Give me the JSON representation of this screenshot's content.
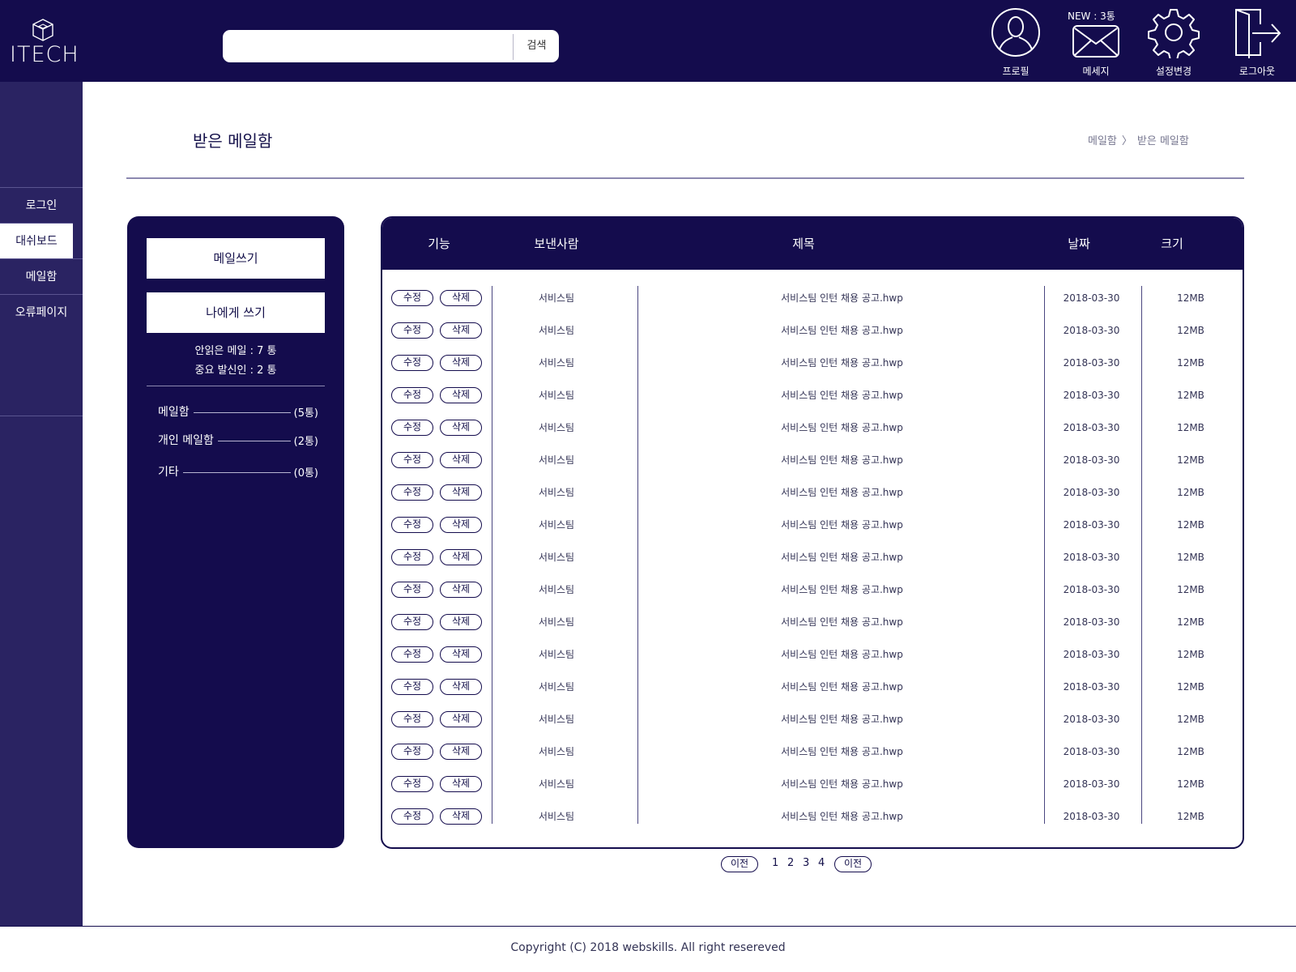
{
  "header": {
    "logo_text": "ITECH",
    "search": {
      "placeholder": "",
      "button": "검색"
    },
    "new_badge": "NEW : 3통",
    "icons": [
      {
        "name": "user-icon",
        "label": "프로필"
      },
      {
        "name": "mail-icon",
        "label": "메세지"
      },
      {
        "name": "gear-icon",
        "label": "설정변경"
      },
      {
        "name": "logout-icon",
        "label": "로그아웃"
      }
    ]
  },
  "nav": {
    "items": [
      {
        "label": "로그인",
        "active": false
      },
      {
        "label": "대쉬보드",
        "active": true
      },
      {
        "label": "메일함",
        "active": false
      },
      {
        "label": "오류페이지",
        "active": false
      }
    ]
  },
  "page": {
    "title": "받은 메일함",
    "breadcrumb": [
      "메일함",
      "〉",
      "받은 메일함"
    ]
  },
  "side": {
    "compose": "메일쓰기",
    "to_self": "나에게 쓰기",
    "unread": "안읽은 메일 : 7 통",
    "important": "중요 발신인 : 2 통",
    "folders": [
      {
        "name": "메일함",
        "count": "(5통)"
      },
      {
        "name": "개인 메일함",
        "count": "(2통)"
      },
      {
        "name": "기타",
        "count": "(0통)"
      }
    ]
  },
  "table": {
    "columns": [
      "기능",
      "보낸사람",
      "제목",
      "날짜",
      "크기"
    ],
    "edit_label": "수정",
    "delete_label": "삭제",
    "rows": [
      {
        "sender": "서비스팀",
        "subject": "서비스팀 인턴 채용 공고.hwp",
        "date": "2018-03-30",
        "size": "12MB"
      },
      {
        "sender": "서비스팀",
        "subject": "서비스팀 인턴 채용 공고.hwp",
        "date": "2018-03-30",
        "size": "12MB"
      },
      {
        "sender": "서비스팀",
        "subject": "서비스팀 인턴 채용 공고.hwp",
        "date": "2018-03-30",
        "size": "12MB"
      },
      {
        "sender": "서비스팀",
        "subject": "서비스팀 인턴 채용 공고.hwp",
        "date": "2018-03-30",
        "size": "12MB"
      },
      {
        "sender": "서비스팀",
        "subject": "서비스팀 인턴 채용 공고.hwp",
        "date": "2018-03-30",
        "size": "12MB"
      },
      {
        "sender": "서비스팀",
        "subject": "서비스팀 인턴 채용 공고.hwp",
        "date": "2018-03-30",
        "size": "12MB"
      },
      {
        "sender": "서비스팀",
        "subject": "서비스팀 인턴 채용 공고.hwp",
        "date": "2018-03-30",
        "size": "12MB"
      },
      {
        "sender": "서비스팀",
        "subject": "서비스팀 인턴 채용 공고.hwp",
        "date": "2018-03-30",
        "size": "12MB"
      },
      {
        "sender": "서비스팀",
        "subject": "서비스팀 인턴 채용 공고.hwp",
        "date": "2018-03-30",
        "size": "12MB"
      },
      {
        "sender": "서비스팀",
        "subject": "서비스팀 인턴 채용 공고.hwp",
        "date": "2018-03-30",
        "size": "12MB"
      },
      {
        "sender": "서비스팀",
        "subject": "서비스팀 인턴 채용 공고.hwp",
        "date": "2018-03-30",
        "size": "12MB"
      },
      {
        "sender": "서비스팀",
        "subject": "서비스팀 인턴 채용 공고.hwp",
        "date": "2018-03-30",
        "size": "12MB"
      },
      {
        "sender": "서비스팀",
        "subject": "서비스팀 인턴 채용 공고.hwp",
        "date": "2018-03-30",
        "size": "12MB"
      },
      {
        "sender": "서비스팀",
        "subject": "서비스팀 인턴 채용 공고.hwp",
        "date": "2018-03-30",
        "size": "12MB"
      },
      {
        "sender": "서비스팀",
        "subject": "서비스팀 인턴 채용 공고.hwp",
        "date": "2018-03-30",
        "size": "12MB"
      },
      {
        "sender": "서비스팀",
        "subject": "서비스팀 인턴 채용 공고.hwp",
        "date": "2018-03-30",
        "size": "12MB"
      },
      {
        "sender": "서비스팀",
        "subject": "서비스팀 인턴 채용 공고.hwp",
        "date": "2018-03-30",
        "size": "12MB"
      }
    ]
  },
  "pagination": {
    "prev": "이전",
    "pages": [
      "1",
      "2",
      "3",
      "4"
    ],
    "next": "이전"
  },
  "footer": {
    "copyright": "Copyright (C) 2018 webskills. All right resereved"
  },
  "colors": {
    "primary": "#140c4d",
    "nav": "#2a2362",
    "rule": "#8c88b0"
  }
}
